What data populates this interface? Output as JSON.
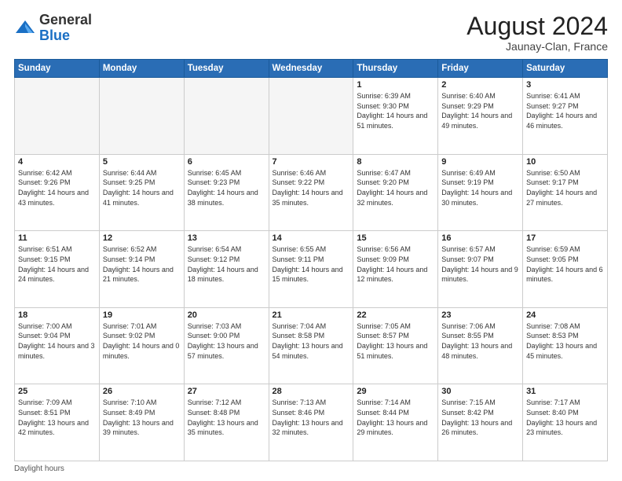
{
  "logo": {
    "general": "General",
    "blue": "Blue"
  },
  "header": {
    "month_year": "August 2024",
    "location": "Jaunay-Clan, France"
  },
  "days_of_week": [
    "Sunday",
    "Monday",
    "Tuesday",
    "Wednesday",
    "Thursday",
    "Friday",
    "Saturday"
  ],
  "weeks": [
    [
      {
        "day": "",
        "info": ""
      },
      {
        "day": "",
        "info": ""
      },
      {
        "day": "",
        "info": ""
      },
      {
        "day": "",
        "info": ""
      },
      {
        "day": "1",
        "info": "Sunrise: 6:39 AM\nSunset: 9:30 PM\nDaylight: 14 hours and 51 minutes."
      },
      {
        "day": "2",
        "info": "Sunrise: 6:40 AM\nSunset: 9:29 PM\nDaylight: 14 hours and 49 minutes."
      },
      {
        "day": "3",
        "info": "Sunrise: 6:41 AM\nSunset: 9:27 PM\nDaylight: 14 hours and 46 minutes."
      }
    ],
    [
      {
        "day": "4",
        "info": "Sunrise: 6:42 AM\nSunset: 9:26 PM\nDaylight: 14 hours and 43 minutes."
      },
      {
        "day": "5",
        "info": "Sunrise: 6:44 AM\nSunset: 9:25 PM\nDaylight: 14 hours and 41 minutes."
      },
      {
        "day": "6",
        "info": "Sunrise: 6:45 AM\nSunset: 9:23 PM\nDaylight: 14 hours and 38 minutes."
      },
      {
        "day": "7",
        "info": "Sunrise: 6:46 AM\nSunset: 9:22 PM\nDaylight: 14 hours and 35 minutes."
      },
      {
        "day": "8",
        "info": "Sunrise: 6:47 AM\nSunset: 9:20 PM\nDaylight: 14 hours and 32 minutes."
      },
      {
        "day": "9",
        "info": "Sunrise: 6:49 AM\nSunset: 9:19 PM\nDaylight: 14 hours and 30 minutes."
      },
      {
        "day": "10",
        "info": "Sunrise: 6:50 AM\nSunset: 9:17 PM\nDaylight: 14 hours and 27 minutes."
      }
    ],
    [
      {
        "day": "11",
        "info": "Sunrise: 6:51 AM\nSunset: 9:15 PM\nDaylight: 14 hours and 24 minutes."
      },
      {
        "day": "12",
        "info": "Sunrise: 6:52 AM\nSunset: 9:14 PM\nDaylight: 14 hours and 21 minutes."
      },
      {
        "day": "13",
        "info": "Sunrise: 6:54 AM\nSunset: 9:12 PM\nDaylight: 14 hours and 18 minutes."
      },
      {
        "day": "14",
        "info": "Sunrise: 6:55 AM\nSunset: 9:11 PM\nDaylight: 14 hours and 15 minutes."
      },
      {
        "day": "15",
        "info": "Sunrise: 6:56 AM\nSunset: 9:09 PM\nDaylight: 14 hours and 12 minutes."
      },
      {
        "day": "16",
        "info": "Sunrise: 6:57 AM\nSunset: 9:07 PM\nDaylight: 14 hours and 9 minutes."
      },
      {
        "day": "17",
        "info": "Sunrise: 6:59 AM\nSunset: 9:05 PM\nDaylight: 14 hours and 6 minutes."
      }
    ],
    [
      {
        "day": "18",
        "info": "Sunrise: 7:00 AM\nSunset: 9:04 PM\nDaylight: 14 hours and 3 minutes."
      },
      {
        "day": "19",
        "info": "Sunrise: 7:01 AM\nSunset: 9:02 PM\nDaylight: 14 hours and 0 minutes."
      },
      {
        "day": "20",
        "info": "Sunrise: 7:03 AM\nSunset: 9:00 PM\nDaylight: 13 hours and 57 minutes."
      },
      {
        "day": "21",
        "info": "Sunrise: 7:04 AM\nSunset: 8:58 PM\nDaylight: 13 hours and 54 minutes."
      },
      {
        "day": "22",
        "info": "Sunrise: 7:05 AM\nSunset: 8:57 PM\nDaylight: 13 hours and 51 minutes."
      },
      {
        "day": "23",
        "info": "Sunrise: 7:06 AM\nSunset: 8:55 PM\nDaylight: 13 hours and 48 minutes."
      },
      {
        "day": "24",
        "info": "Sunrise: 7:08 AM\nSunset: 8:53 PM\nDaylight: 13 hours and 45 minutes."
      }
    ],
    [
      {
        "day": "25",
        "info": "Sunrise: 7:09 AM\nSunset: 8:51 PM\nDaylight: 13 hours and 42 minutes."
      },
      {
        "day": "26",
        "info": "Sunrise: 7:10 AM\nSunset: 8:49 PM\nDaylight: 13 hours and 39 minutes."
      },
      {
        "day": "27",
        "info": "Sunrise: 7:12 AM\nSunset: 8:48 PM\nDaylight: 13 hours and 35 minutes."
      },
      {
        "day": "28",
        "info": "Sunrise: 7:13 AM\nSunset: 8:46 PM\nDaylight: 13 hours and 32 minutes."
      },
      {
        "day": "29",
        "info": "Sunrise: 7:14 AM\nSunset: 8:44 PM\nDaylight: 13 hours and 29 minutes."
      },
      {
        "day": "30",
        "info": "Sunrise: 7:15 AM\nSunset: 8:42 PM\nDaylight: 13 hours and 26 minutes."
      },
      {
        "day": "31",
        "info": "Sunrise: 7:17 AM\nSunset: 8:40 PM\nDaylight: 13 hours and 23 minutes."
      }
    ]
  ],
  "footer": {
    "daylight_label": "Daylight hours"
  }
}
